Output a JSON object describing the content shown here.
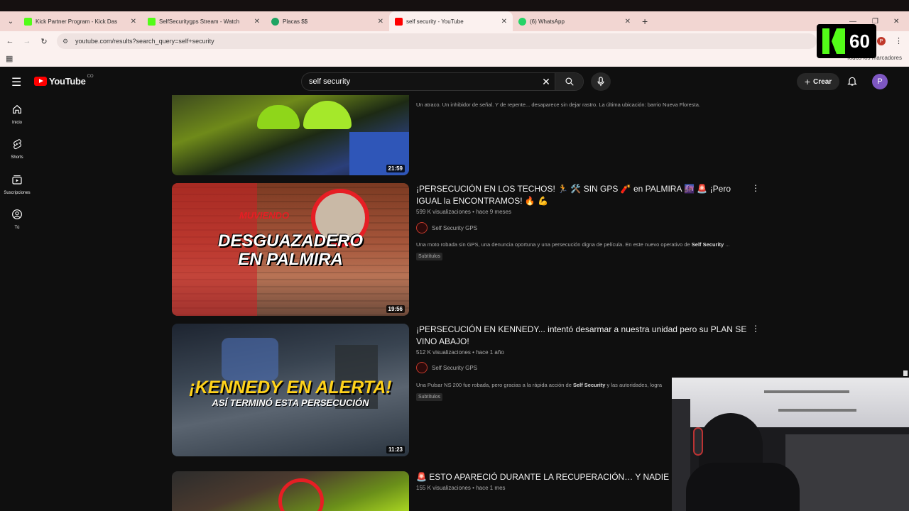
{
  "browser": {
    "tabs": [
      {
        "title": "Kick Partner Program - Kick Das",
        "icon_color": "#53fc18"
      },
      {
        "title": "SelfSecuritygps Stream - Watch",
        "icon_color": "#53fc18"
      },
      {
        "title": "Placas $$",
        "icon_color": "#1fa463"
      },
      {
        "title": "self security - YouTube",
        "icon_color": "#ff0000",
        "active": true
      },
      {
        "title": "(6) WhatsApp",
        "icon_color": "#25d366"
      }
    ],
    "url": "youtube.com/results?search_query=self+security",
    "bookmarks_label": "Todos los marcadores",
    "profile_letter": "P"
  },
  "overlay": {
    "kick_viewers": "60"
  },
  "youtube": {
    "logo_text": "YouTube",
    "country": "CO",
    "search_query": "self security",
    "create_label": "Crear",
    "avatar_letter": "P",
    "sidebar": [
      {
        "label": "Inicio",
        "icon": "home-icon"
      },
      {
        "label": "Shorts",
        "icon": "shorts-icon"
      },
      {
        "label": "Suscripciones",
        "icon": "subscriptions-icon"
      },
      {
        "label": "Tú",
        "icon": "you-icon"
      }
    ],
    "results": [
      {
        "description": "Un atraco. Un inhibidor de señal. Y de repente... desaparece sin dejar rastro. La última ubicación: barrio Nueva Floresta.",
        "duration": "21:59"
      },
      {
        "title": "¡PERSECUCIÓN EN LOS TECHOS! 🏃 🛠️ SIN GPS 🧨 en PALMIRA 🌆 🚨 ¡Pero IGUAL la ENCONTRAMOS! 🔥 💪",
        "views": "599 K visualizaciones",
        "age": "hace 9 meses",
        "channel": "Self Security GPS",
        "description_prefix": "Una moto robada sin GPS, una denuncia oportuna y una persecución digna de película. En este nuevo operativo de ",
        "description_bold": "Self Security",
        "description_suffix": " ...",
        "badge": "Subtítulos",
        "duration": "19:56",
        "thumb_top_text": "MUVIENDO",
        "thumb_line1": "DESGUAZADERO",
        "thumb_line2": "EN PALMIRA"
      },
      {
        "title": "¡PERSECUCIÓN EN KENNEDY... intentó desarmar a nuestra unidad pero su PLAN SE VINO ABAJO!",
        "views": "512 K visualizaciones",
        "age": "hace 1 año",
        "channel": "Self Security GPS",
        "description_prefix": "Una Pulsar NS 200 fue robada, pero gracias a la rápida acción de ",
        "description_bold": "Self Security",
        "description_suffix": " y las autoridades, logra",
        "badge": "Subtítulos",
        "duration": "11:23",
        "thumb_line1": "¡KENNEDY EN ALERTA!",
        "thumb_line2": "ASÍ TERMINÓ ESTA PERSECUCIÓN"
      },
      {
        "title": "🚨 ESTO APARECIÓ DURANTE LA RECUPERACIÓN… Y NADIE LO ES",
        "views": "155 K visualizaciones",
        "age": "hace 1 mes"
      }
    ]
  }
}
